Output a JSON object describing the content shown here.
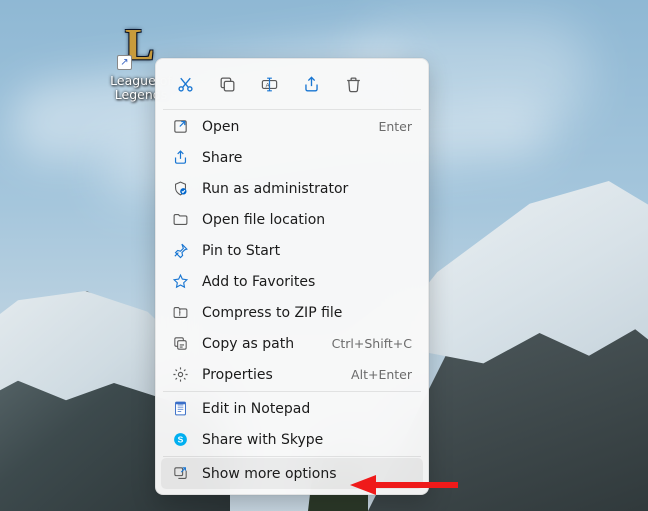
{
  "desktop": {
    "icon_name": "League of Legends",
    "shortcut_glyph": "↗"
  },
  "toolbar": [
    {
      "id": "cut",
      "name": "cut-icon"
    },
    {
      "id": "copy",
      "name": "copy-icon"
    },
    {
      "id": "rename",
      "name": "rename-icon"
    },
    {
      "id": "share",
      "name": "share-icon"
    },
    {
      "id": "delete",
      "name": "delete-icon"
    }
  ],
  "menu": {
    "groups": [
      [
        {
          "id": "open",
          "icon": "open",
          "label": "Open",
          "shortcut": "Enter"
        },
        {
          "id": "share",
          "icon": "share",
          "label": "Share"
        },
        {
          "id": "runadmin",
          "icon": "shield",
          "label": "Run as administrator"
        },
        {
          "id": "openloc",
          "icon": "folder",
          "label": "Open file location"
        },
        {
          "id": "pinstart",
          "icon": "pin",
          "label": "Pin to Start"
        },
        {
          "id": "addfav",
          "icon": "star",
          "label": "Add to Favorites"
        },
        {
          "id": "zip",
          "icon": "zip",
          "label": "Compress to ZIP file"
        },
        {
          "id": "copypath",
          "icon": "copypath",
          "label": "Copy as path",
          "shortcut": "Ctrl+Shift+C"
        },
        {
          "id": "props",
          "icon": "props",
          "label": "Properties",
          "shortcut": "Alt+Enter"
        }
      ],
      [
        {
          "id": "notepad",
          "icon": "notepad",
          "label": "Edit in Notepad"
        },
        {
          "id": "skype",
          "icon": "skype",
          "label": "Share with Skype"
        }
      ],
      [
        {
          "id": "more",
          "icon": "more",
          "label": "Show more options",
          "highlight": true
        }
      ]
    ]
  },
  "colors": {
    "accent_blue": "#1976d2",
    "skype_blue": "#00aff0",
    "shield_blue": "#0066cc",
    "icon_gray": "#5a5a5a"
  },
  "annotation": {
    "arrow_color": "#ef1a1a"
  }
}
